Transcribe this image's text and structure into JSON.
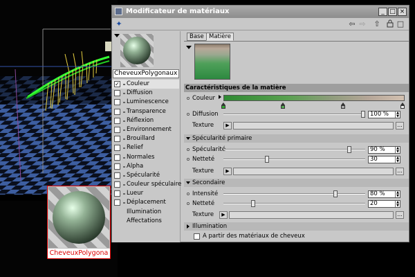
{
  "window": {
    "title": "Modificateur de matériaux",
    "minimize_glyph": "_",
    "maximize_glyph": "□",
    "close_glyph": "×"
  },
  "toolbar": {
    "back_glyph": "⇦",
    "forward_glyph": "⇨",
    "up_glyph": "⇧",
    "lock_glyph": "🔒",
    "new_glyph": "□"
  },
  "material": {
    "name": "CheveuxPolygonaux",
    "preview_label": "CheveuxPolygona"
  },
  "channels": [
    {
      "label": "Couleur",
      "checked": true,
      "has_checkbox": true,
      "selected": true
    },
    {
      "label": "Diffusion",
      "checked": false,
      "has_checkbox": true
    },
    {
      "label": "Luminescence",
      "checked": false,
      "has_checkbox": true
    },
    {
      "label": "Transparence",
      "checked": false,
      "has_checkbox": true
    },
    {
      "label": "Réflexion",
      "checked": false,
      "has_checkbox": true
    },
    {
      "label": "Environnement",
      "checked": false,
      "has_checkbox": true
    },
    {
      "label": "Brouillard",
      "checked": false,
      "has_checkbox": true
    },
    {
      "label": "Relief",
      "checked": false,
      "has_checkbox": true
    },
    {
      "label": "Normales",
      "checked": false,
      "has_checkbox": true
    },
    {
      "label": "Alpha",
      "checked": false,
      "has_checkbox": true
    },
    {
      "label": "Spécularité",
      "checked": false,
      "has_checkbox": true
    },
    {
      "label": "Couleur spéculaire",
      "checked": false,
      "has_checkbox": true
    },
    {
      "label": "Lueur",
      "checked": false,
      "has_checkbox": true
    },
    {
      "label": "Déplacement",
      "checked": false,
      "has_checkbox": true
    },
    {
      "label": "Illumination",
      "checked": false,
      "has_checkbox": false
    },
    {
      "label": "Affectations",
      "checked": false,
      "has_checkbox": false
    }
  ],
  "tabs": [
    {
      "label": "Base",
      "active": false
    },
    {
      "label": "Matière",
      "active": true
    }
  ],
  "section_title": "Caractéristiques de la matière",
  "couleur": {
    "label": "Couleur",
    "gradient_stops": 4
  },
  "diffusion": {
    "label": "Diffusion",
    "value": "100 %",
    "level": 1.0
  },
  "texture_label": "Texture",
  "dots_glyph": "...",
  "specular_primary": {
    "header": "Spécularité primaire",
    "specularite": {
      "label": "Spécularité",
      "value": "90 %",
      "level": 0.9
    },
    "nettete": {
      "label": "Netteté",
      "value": "30",
      "level": 0.3
    }
  },
  "secondary": {
    "header": "Secondaire",
    "intensite": {
      "label": "Intensité",
      "value": "80 %",
      "level": 0.8
    },
    "nettete": {
      "label": "Netteté",
      "value": "20",
      "level": 0.2
    }
  },
  "illumination_header": "Illumination",
  "hair_option": {
    "label": "A partir des matériaux de cheveux",
    "checked": false
  },
  "colors": {
    "title_bar": "#9a9a9a",
    "panel": "#c8c8c8",
    "accent_red": "#dd0000",
    "hair_green": "#33ff33",
    "hair_yellow": "#e8d040"
  }
}
